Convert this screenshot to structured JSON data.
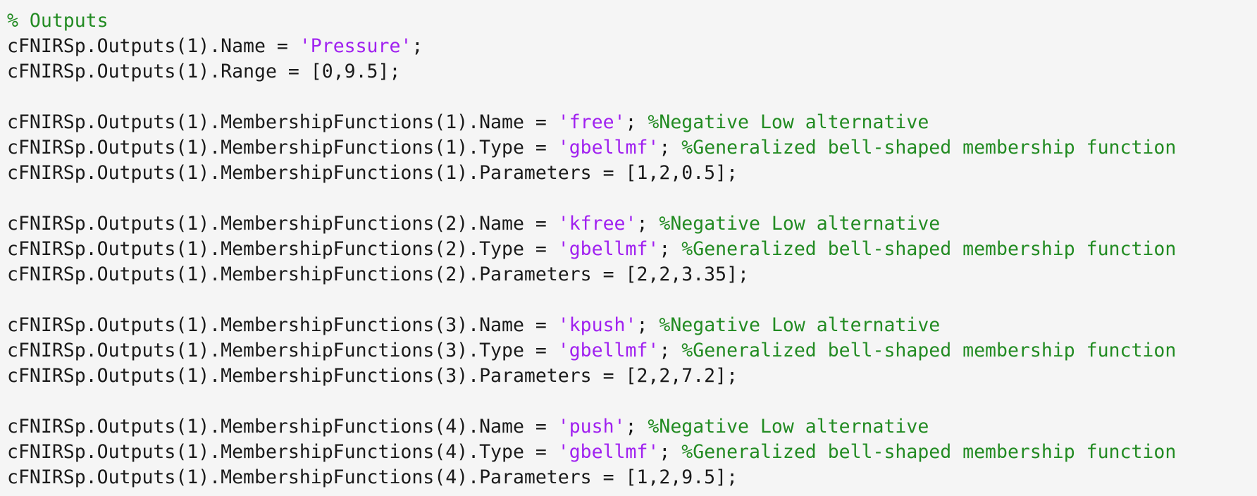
{
  "editor": {
    "lines": [
      [
        {
          "type": "comment",
          "text": "% Outputs"
        }
      ],
      [
        {
          "type": "code",
          "text": "cFNIRSp.Outputs(1).Name = "
        },
        {
          "type": "string",
          "text": "'Pressure'"
        },
        {
          "type": "code",
          "text": ";"
        }
      ],
      [
        {
          "type": "code",
          "text": "cFNIRSp.Outputs(1).Range = [0,9.5];"
        }
      ],
      [],
      [
        {
          "type": "code",
          "text": "cFNIRSp.Outputs(1).MembershipFunctions(1).Name = "
        },
        {
          "type": "string",
          "text": "'free'"
        },
        {
          "type": "code",
          "text": "; "
        },
        {
          "type": "comment",
          "text": "%Negative Low alternative"
        }
      ],
      [
        {
          "type": "code",
          "text": "cFNIRSp.Outputs(1).MembershipFunctions(1).Type = "
        },
        {
          "type": "string",
          "text": "'gbellmf'"
        },
        {
          "type": "code",
          "text": "; "
        },
        {
          "type": "comment",
          "text": "%Generalized bell-shaped membership function"
        }
      ],
      [
        {
          "type": "code",
          "text": "cFNIRSp.Outputs(1).MembershipFunctions(1).Parameters = [1,2,0.5];"
        }
      ],
      [],
      [
        {
          "type": "code",
          "text": "cFNIRSp.Outputs(1).MembershipFunctions(2).Name = "
        },
        {
          "type": "string",
          "text": "'kfree'"
        },
        {
          "type": "code",
          "text": "; "
        },
        {
          "type": "comment",
          "text": "%Negative Low alternative"
        }
      ],
      [
        {
          "type": "code",
          "text": "cFNIRSp.Outputs(1).MembershipFunctions(2).Type = "
        },
        {
          "type": "string",
          "text": "'gbellmf'"
        },
        {
          "type": "code",
          "text": "; "
        },
        {
          "type": "comment",
          "text": "%Generalized bell-shaped membership function"
        }
      ],
      [
        {
          "type": "code",
          "text": "cFNIRSp.Outputs(1).MembershipFunctions(2).Parameters = [2,2,3.35];"
        }
      ],
      [],
      [
        {
          "type": "code",
          "text": "cFNIRSp.Outputs(1).MembershipFunctions(3).Name = "
        },
        {
          "type": "string",
          "text": "'kpush'"
        },
        {
          "type": "code",
          "text": "; "
        },
        {
          "type": "comment",
          "text": "%Negative Low alternative"
        }
      ],
      [
        {
          "type": "code",
          "text": "cFNIRSp.Outputs(1).MembershipFunctions(3).Type = "
        },
        {
          "type": "string",
          "text": "'gbellmf'"
        },
        {
          "type": "code",
          "text": "; "
        },
        {
          "type": "comment",
          "text": "%Generalized bell-shaped membership function"
        }
      ],
      [
        {
          "type": "code",
          "text": "cFNIRSp.Outputs(1).MembershipFunctions(3).Parameters = [2,2,7.2];"
        }
      ],
      [],
      [
        {
          "type": "code",
          "text": "cFNIRSp.Outputs(1).MembershipFunctions(4).Name = "
        },
        {
          "type": "string",
          "text": "'push'"
        },
        {
          "type": "code",
          "text": "; "
        },
        {
          "type": "comment",
          "text": "%Negative Low alternative"
        }
      ],
      [
        {
          "type": "code",
          "text": "cFNIRSp.Outputs(1).MembershipFunctions(4).Type = "
        },
        {
          "type": "string",
          "text": "'gbellmf'"
        },
        {
          "type": "code",
          "text": "; "
        },
        {
          "type": "comment",
          "text": "%Generalized bell-shaped membership function"
        }
      ],
      [
        {
          "type": "code",
          "text": "cFNIRSp.Outputs(1).MembershipFunctions(4).Parameters = [1,2,9.5];"
        }
      ]
    ]
  },
  "colors": {
    "background": "#f5f5f5",
    "code": "#1a1a1a",
    "string": "#a020f0",
    "comment": "#228b22"
  }
}
